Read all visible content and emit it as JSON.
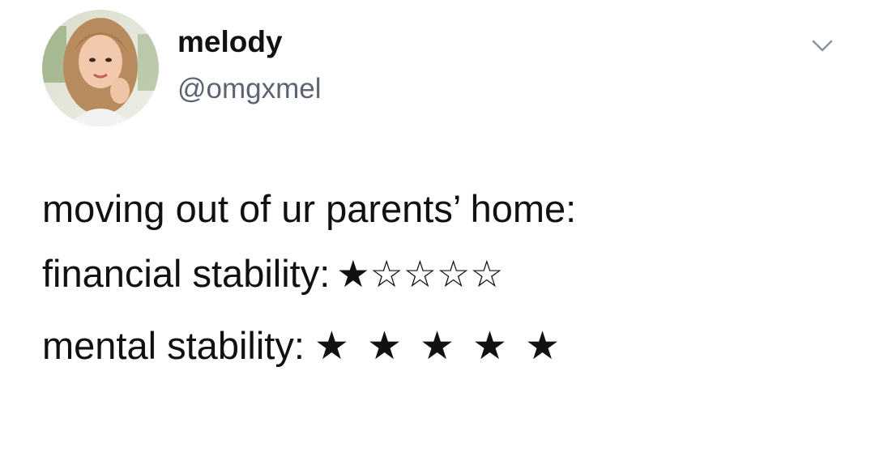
{
  "tweet": {
    "author": {
      "display_name": "melody",
      "handle": "@omgxmel"
    },
    "text": {
      "line1": "moving out of ur parents’ home:",
      "line2_label": "financial stability:",
      "line3_label": "mental stability:"
    },
    "ratings": {
      "financial_stability": {
        "filled": 1,
        "total": 5
      },
      "mental_stability": {
        "filled": 5,
        "total": 5
      }
    },
    "icons": {
      "menu": "chevron-down-icon",
      "star_filled": "★",
      "star_empty": "☆"
    }
  }
}
